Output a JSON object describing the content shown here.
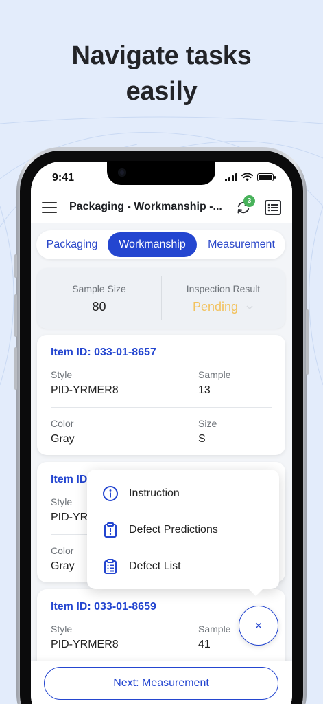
{
  "headline": {
    "line1": "Navigate tasks",
    "line2": "easily"
  },
  "status_bar": {
    "time": "9:41"
  },
  "app_bar": {
    "title": "Packaging - Workmanship -...",
    "sync_badge": "3"
  },
  "tabs": [
    {
      "label": "Packaging",
      "active": false
    },
    {
      "label": "Workmanship",
      "active": true
    },
    {
      "label": "Measurement",
      "active": false
    }
  ],
  "summary": {
    "sample_size_label": "Sample Size",
    "sample_size_value": "80",
    "result_label": "Inspection Result",
    "result_value": "Pending"
  },
  "items": [
    {
      "item_id": "Item ID: 033-01-8657",
      "style_label": "Style",
      "style": "PID-YRMER8",
      "sample_label": "Sample",
      "sample": "13",
      "color_label": "Color",
      "color": "Gray",
      "size_label": "Size",
      "size": "S"
    },
    {
      "item_id": "Item ID",
      "style_label": "Style",
      "style": "PID-YR",
      "color_label": "Color",
      "color": "Gray"
    },
    {
      "item_id": "Item ID: 033-01-8659",
      "style_label": "Style",
      "style": "PID-YRMER8",
      "sample_label": "Sample",
      "sample": "41"
    }
  ],
  "popup_menu": [
    {
      "label": "Instruction",
      "icon": "info-icon"
    },
    {
      "label": "Defect Predictions",
      "icon": "clipboard-alert-icon"
    },
    {
      "label": "Defect List",
      "icon": "clipboard-list-icon"
    }
  ],
  "fab": {
    "label": "×"
  },
  "bottom": {
    "next_label": "Next: Measurement"
  },
  "colors": {
    "accent": "#2446d0",
    "pending": "#f2c25e",
    "badge": "#48b25b",
    "background": "#e3ecfb"
  }
}
